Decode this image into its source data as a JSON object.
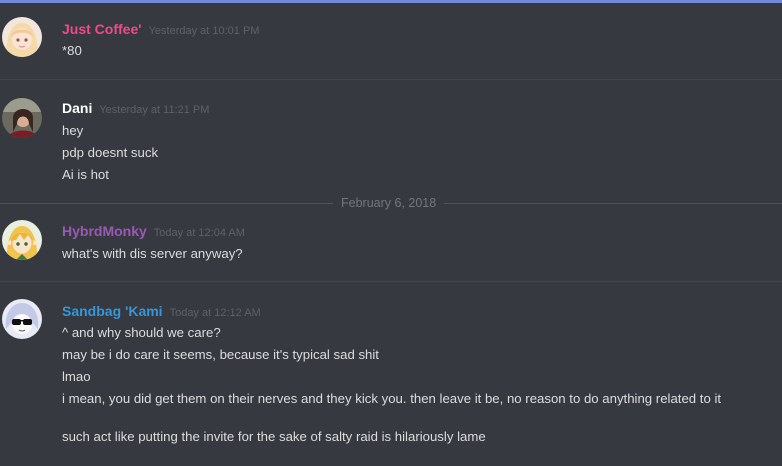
{
  "colors": {
    "background": "#36393f",
    "accent_bar": "#7289da",
    "text": "#dcddde",
    "timestamp": "#5e6168"
  },
  "date_separator": "February 6, 2018",
  "messages": [
    {
      "author": "Just Coffee'",
      "author_color": "#f04a8c",
      "timestamp": "Yesterday at 10:01 PM",
      "avatar": "anime-girl-blonde-avatar",
      "lines": [
        "*80"
      ]
    },
    {
      "author": "Dani",
      "author_color": "#ffffff",
      "timestamp": "Yesterday at 11:21 PM",
      "avatar": "photo-avatar",
      "lines": [
        "hey",
        "pdp doesnt suck",
        "Ai is hot"
      ]
    },
    {
      "author": "HybrdMonky",
      "author_color": "#9b59b6",
      "timestamp": "Today at 12:04 AM",
      "avatar": "anime-blonde-elf-avatar",
      "lines": [
        "what's with dis server anyway?"
      ]
    },
    {
      "author": "Sandbag 'Kami",
      "author_color": "#3498db",
      "timestamp": "Today at 12:12 AM",
      "avatar": "sunglasses-character-avatar",
      "lines": [
        "^ and why should we care?",
        "may be i do care it seems, because it's typical sad shit",
        "lmao",
        "i mean, you did get them on their nerves and they kick you. then leave it be, no reason to do anything related to it",
        "such act like putting the invite for the sake of salty raid is hilariously lame"
      ]
    }
  ]
}
